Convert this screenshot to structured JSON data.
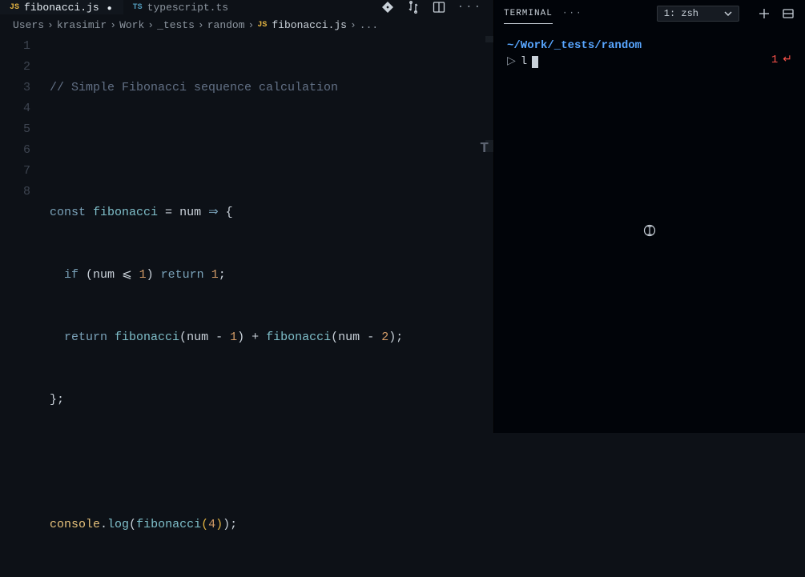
{
  "tabs": [
    {
      "lang": "JS",
      "label": "fibonacci.js",
      "active": true
    },
    {
      "lang": "TS",
      "label": "typescript.ts",
      "active": false
    }
  ],
  "breadcrumb": {
    "parts": [
      "Users",
      "krasimir",
      "Work",
      "_tests",
      "random"
    ],
    "file_icon": "JS",
    "file": "fibonacci.js",
    "tail": "..."
  },
  "editor": {
    "line_numbers": [
      "1",
      "2",
      "3",
      "4",
      "5",
      "6",
      "7",
      "8"
    ],
    "minimap_letter": "T",
    "lines": {
      "l1_comment": "// Simple Fibonacci sequence calculation",
      "l3": {
        "kw": "const",
        "name": "fibonacci",
        "eq": " = ",
        "arg": "num",
        "arrow": " ⇒ ",
        "brace": "{"
      },
      "l4": {
        "indent": "  ",
        "kw": "if",
        "open": " (",
        "id": "num",
        "op": " ⩽ ",
        "n": "1",
        "close": ")",
        "ret": " return ",
        "v": "1",
        "semi": ";"
      },
      "l5": {
        "indent": "  ",
        "ret": "return ",
        "fn1": "fibonacci",
        "o1": "(",
        "id1": "num",
        "op1": " - ",
        "n1": "1",
        "c1": ")",
        "plus": " + ",
        "fn2": "fibonacci",
        "o2": "(",
        "id2": "num",
        "op2": " - ",
        "n2": "2",
        "c2": ")",
        "semi": ";"
      },
      "l6": {
        "brace": "};"
      },
      "l8": {
        "obj": "console",
        "dot": ".",
        "m": "log",
        "o": "(",
        "fn": "fibonacci",
        "o2": "(",
        "n": "4",
        "c2": ")",
        "c": ")",
        "semi": ";"
      }
    }
  },
  "terminal": {
    "header": {
      "title": "TERMINAL",
      "ellipsis": "···",
      "selector": "1: zsh"
    },
    "cwd": "~/Work/_tests/random",
    "prompt": "▷",
    "input": "l",
    "status_code": "1",
    "status_glyph": "↵"
  }
}
